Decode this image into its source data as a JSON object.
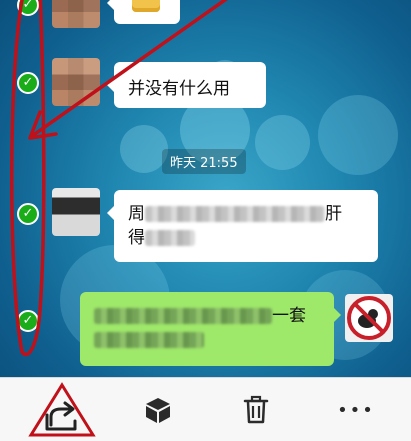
{
  "chat": {
    "time_divider": "昨天 21:55",
    "messages": [
      {
        "side": "left",
        "text": "",
        "note": "partially visible top message with emoji sticker"
      },
      {
        "side": "left",
        "text": "并没有什么用"
      },
      {
        "side": "left",
        "text_start": "周",
        "text_end": "肝",
        "line2_start": "得"
      },
      {
        "side": "right",
        "text_end": "一套"
      }
    ],
    "check_symbol": "✓"
  },
  "toolbar": {
    "items": [
      {
        "icon": "share-icon"
      },
      {
        "icon": "box-icon"
      },
      {
        "icon": "trash-icon"
      },
      {
        "icon": "more-icon",
        "label": "•••"
      }
    ]
  },
  "colors": {
    "accent_green": "#1aad19",
    "bubble_green": "#9ee86a",
    "annotation_red": "#c0101a"
  }
}
